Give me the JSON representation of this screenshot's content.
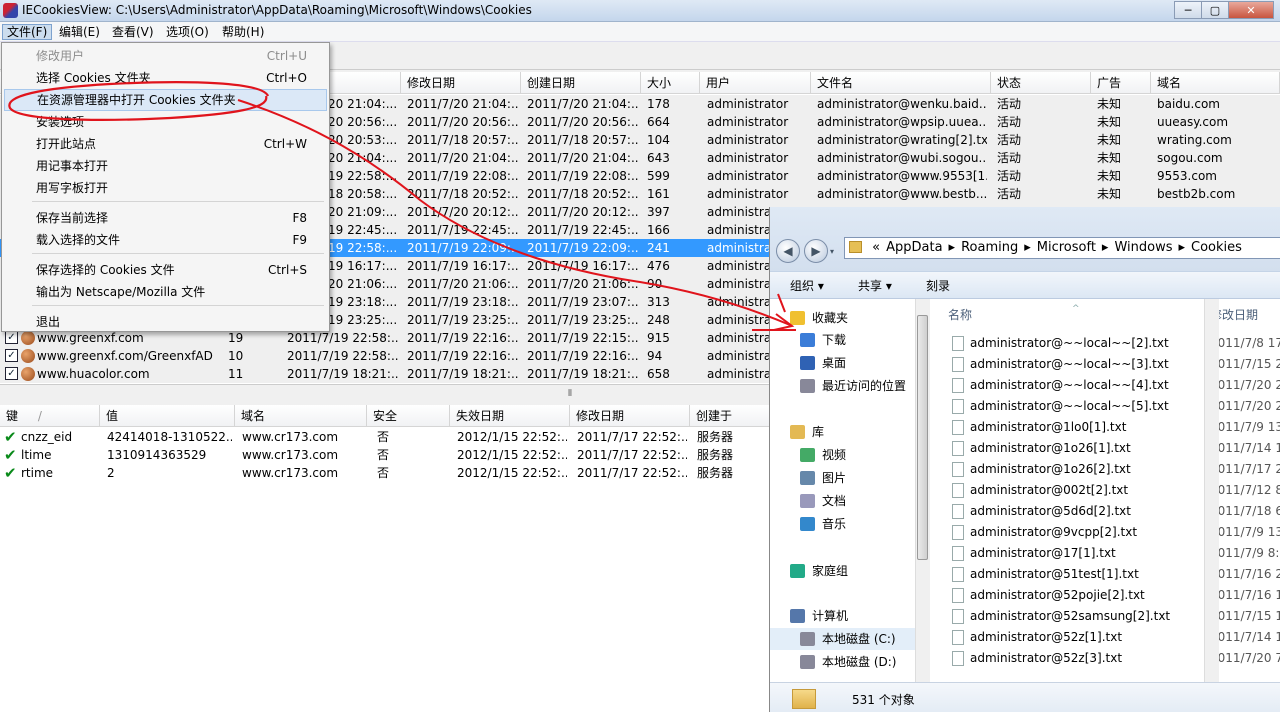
{
  "app": {
    "title": "IECookiesView:  C:\\Users\\Administrator\\AppData\\Roaming\\Microsoft\\Windows\\Cookies",
    "window_buttons": {
      "minimize": "─",
      "maximize": "▢",
      "close": "✕"
    }
  },
  "menubar": [
    "文件(F)",
    "编辑(E)",
    "查看(V)",
    "选项(O)",
    "帮助(H)"
  ],
  "file_menu": [
    {
      "label": "修改用户",
      "shortcut": "Ctrl+U",
      "disabled": true
    },
    {
      "label": "选择 Cookies 文件夹",
      "shortcut": "Ctrl+O"
    },
    {
      "label": "在资源管理器中打开 Cookies 文件夹",
      "shortcut": ""
    },
    {
      "label": "安装选项",
      "shortcut": ""
    },
    {
      "label": "打开此站点",
      "shortcut": "Ctrl+W"
    },
    {
      "label": "用记事本打开",
      "shortcut": ""
    },
    {
      "label": "用写字板打开",
      "shortcut": ""
    },
    {
      "label": "保存当前选择",
      "shortcut": "F8"
    },
    {
      "label": "载入选择的文件",
      "shortcut": "F9"
    },
    {
      "label": "保存选择的 Cookies 文件",
      "shortcut": "Ctrl+S"
    },
    {
      "label": "输出为 Netscape/Mozilla 文件",
      "shortcut": ""
    },
    {
      "label": "退出",
      "shortcut": ""
    }
  ],
  "upper_columns": [
    "期",
    "修改日期",
    "创建日期",
    "大小",
    "用户",
    "文件名",
    "状态",
    "广告",
    "域名"
  ],
  "upper_rows": [
    {
      "c3": "20 21:04:...",
      "mod": "2011/7/20 21:04:...",
      "cre": "2011/7/20 21:04:...",
      "size": "178",
      "user": "administrator",
      "file": "administrator@wenku.baid...",
      "status": "活动",
      "ad": "未知",
      "domain": "baidu.com"
    },
    {
      "c3": "20 20:56:...",
      "mod": "2011/7/20 20:56:...",
      "cre": "2011/7/20 20:56:...",
      "size": "664",
      "user": "administrator",
      "file": "administrator@wpsip.uuea...",
      "status": "活动",
      "ad": "未知",
      "domain": "uueasy.com"
    },
    {
      "c3": "20 20:53:...",
      "mod": "2011/7/18 20:57:...",
      "cre": "2011/7/18 20:57:...",
      "size": "104",
      "user": "administrator",
      "file": "administrator@wrating[2].txt",
      "status": "活动",
      "ad": "未知",
      "domain": "wrating.com"
    },
    {
      "c3": "20 21:04:...",
      "mod": "2011/7/20 21:04:...",
      "cre": "2011/7/20 21:04:...",
      "size": "643",
      "user": "administrator",
      "file": "administrator@wubi.sogou...",
      "status": "活动",
      "ad": "未知",
      "domain": "sogou.com"
    },
    {
      "c3": "19 22:58:...",
      "mod": "2011/7/19 22:08:...",
      "cre": "2011/7/19 22:08:...",
      "size": "599",
      "user": "administrator",
      "file": "administrator@www.9553[1...",
      "status": "活动",
      "ad": "未知",
      "domain": "9553.com"
    },
    {
      "c3": "18 20:58:...",
      "mod": "2011/7/18 20:52:...",
      "cre": "2011/7/18 20:52:...",
      "size": "161",
      "user": "administrator",
      "file": "administrator@www.bestb...",
      "status": "活动",
      "ad": "未知",
      "domain": "bestb2b.com"
    },
    {
      "c3": "20 21:09:...",
      "mod": "2011/7/20 20:12:...",
      "cre": "2011/7/20 20:12:...",
      "size": "397",
      "user": "administra",
      "file": "",
      "status": "",
      "ad": "",
      "domain": ""
    },
    {
      "c3": "19 22:45:...",
      "mod": "2011/7/19 22:45:...",
      "cre": "2011/7/19 22:45:...",
      "size": "166",
      "user": "administra",
      "file": "",
      "status": "",
      "ad": "",
      "domain": ""
    },
    {
      "c3": "19 22:58:...",
      "mod": "2011/7/19 22:09:...",
      "cre": "2011/7/19 22:09:...",
      "size": "241",
      "user": "administra",
      "file": "",
      "status": "",
      "ad": "",
      "domain": "",
      "selected": true
    },
    {
      "c3": "19 16:17:...",
      "mod": "2011/7/19 16:17:...",
      "cre": "2011/7/19 16:17:...",
      "size": "476",
      "user": "administra",
      "file": "",
      "status": "",
      "ad": "",
      "domain": ""
    },
    {
      "c3": "20 21:06:...",
      "mod": "2011/7/20 21:06:...",
      "cre": "2011/7/20 21:06:...",
      "size": "90",
      "user": "administra",
      "file": "",
      "status": "",
      "ad": "",
      "domain": ""
    },
    {
      "c3": "19 23:18:...",
      "mod": "2011/7/19 23:18:...",
      "cre": "2011/7/19 23:07:...",
      "size": "313",
      "user": "administra",
      "file": "",
      "status": "",
      "ad": "",
      "domain": ""
    },
    {
      "c3": "19 23:25:...",
      "mod": "2011/7/19 23:25:...",
      "cre": "2011/7/19 23:25:...",
      "size": "248",
      "user": "administra",
      "file": "",
      "status": "",
      "ad": "",
      "domain": ""
    },
    {
      "site": "www.greenxf.com",
      "count": "19",
      "c3": "2011/7/19 22:58:...",
      "mod": "2011/7/19 22:16:...",
      "cre": "2011/7/19 22:15:...",
      "size": "915",
      "user": "administra",
      "file": "",
      "status": "",
      "ad": "",
      "domain": ""
    },
    {
      "site": "www.greenxf.com/GreenxfAD",
      "count": "10",
      "c3": "2011/7/19 22:58:...",
      "mod": "2011/7/19 22:16:...",
      "cre": "2011/7/19 22:16:...",
      "size": "94",
      "user": "administra",
      "file": "",
      "status": "",
      "ad": "",
      "domain": ""
    },
    {
      "site": "www.huacolor.com",
      "count": "11",
      "c3": "2011/7/19 18:21:...",
      "mod": "2011/7/19 18:21:...",
      "cre": "2011/7/19 18:21:...",
      "size": "658",
      "user": "administra",
      "file": "",
      "status": "",
      "ad": "",
      "domain": ""
    }
  ],
  "lower_columns": [
    "键",
    "值",
    "域名",
    "安全",
    "失效日期",
    "修改日期",
    "创建于"
  ],
  "lower_sort_glyph": "/",
  "lower_rows": [
    {
      "key": "cnzz_eid",
      "value": "42414018-1310522...",
      "domain": "www.cr173.com",
      "secure": "否",
      "expires": "2012/1/15 22:52:...",
      "modified": "2011/7/17 22:52:...",
      "created": "服务器"
    },
    {
      "key": "ltime",
      "value": "1310914363529",
      "domain": "www.cr173.com",
      "secure": "否",
      "expires": "2012/1/15 22:52:...",
      "modified": "2011/7/17 22:52:...",
      "created": "服务器"
    },
    {
      "key": "rtime",
      "value": "2",
      "domain": "www.cr173.com",
      "secure": "否",
      "expires": "2012/1/15 22:52:...",
      "modified": "2011/7/17 22:52:...",
      "created": "服务器"
    }
  ],
  "explorer": {
    "breadcrumb": [
      "«",
      "AppData",
      "▸",
      "Roaming",
      "▸",
      "Microsoft",
      "▸",
      "Windows",
      "▸",
      "Cookies"
    ],
    "commands": {
      "organize": "组织 ▾",
      "share": "共享 ▾",
      "burn": "刻录"
    },
    "nav": [
      {
        "label": "收藏夹",
        "icon": "star-icon"
      },
      {
        "label": "下载",
        "icon": "download-folder-icon"
      },
      {
        "label": "桌面",
        "icon": "desktop-icon"
      },
      {
        "label": "最近访问的位置",
        "icon": "recent-places-icon"
      },
      {
        "label": "库",
        "icon": "library-icon"
      },
      {
        "label": "视频",
        "icon": "video-icon"
      },
      {
        "label": "图片",
        "icon": "pictures-icon"
      },
      {
        "label": "文档",
        "icon": "documents-icon"
      },
      {
        "label": "音乐",
        "icon": "music-icon"
      },
      {
        "label": "家庭组",
        "icon": "homegroup-icon"
      },
      {
        "label": "计算机",
        "icon": "computer-icon"
      },
      {
        "label": "本地磁盘 (C:)",
        "icon": "drive-c-icon"
      },
      {
        "label": "本地磁盘 (D:)",
        "icon": "drive-d-icon"
      }
    ],
    "columns": {
      "name": "名称",
      "modified": "修改日期"
    },
    "files": [
      {
        "name": "administrator@~~local~~[2].txt",
        "date": "2011/7/8 17"
      },
      {
        "name": "administrator@~~local~~[3].txt",
        "date": "2011/7/15 2"
      },
      {
        "name": "administrator@~~local~~[4].txt",
        "date": "2011/7/20 2"
      },
      {
        "name": "administrator@~~local~~[5].txt",
        "date": "2011/7/20 2"
      },
      {
        "name": "administrator@1lo0[1].txt",
        "date": "2011/7/9 13"
      },
      {
        "name": "administrator@1o26[1].txt",
        "date": "2011/7/14 1"
      },
      {
        "name": "administrator@1o26[2].txt",
        "date": "2011/7/17 2"
      },
      {
        "name": "administrator@002t[2].txt",
        "date": "2011/7/12 8"
      },
      {
        "name": "administrator@5d6d[2].txt",
        "date": "2011/7/18 6"
      },
      {
        "name": "administrator@9vcpp[2].txt",
        "date": "2011/7/9 13"
      },
      {
        "name": "administrator@17[1].txt",
        "date": "2011/7/9 8:3"
      },
      {
        "name": "administrator@51test[1].txt",
        "date": "2011/7/16 2"
      },
      {
        "name": "administrator@52pojie[2].txt",
        "date": "2011/7/16 1"
      },
      {
        "name": "administrator@52samsung[2].txt",
        "date": "2011/7/15 1"
      },
      {
        "name": "administrator@52z[1].txt",
        "date": "2011/7/14 1"
      },
      {
        "name": "administrator@52z[3].txt",
        "date": "2011/7/20 7"
      }
    ],
    "status": "531 个对象"
  },
  "colors": {
    "selection": "#3399ff",
    "annotation": "#e0141c"
  }
}
